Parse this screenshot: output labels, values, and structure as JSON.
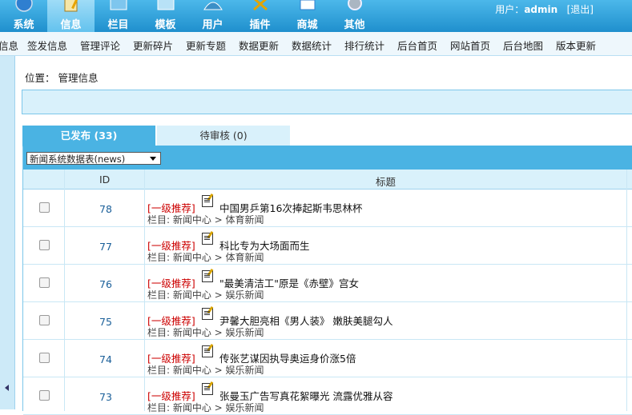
{
  "header": {
    "nav": [
      {
        "label": "系统",
        "icon": "globe-icon"
      },
      {
        "label": "信息",
        "icon": "notepad-icon",
        "active": true
      },
      {
        "label": "栏目",
        "icon": "window-icon"
      },
      {
        "label": "模板",
        "icon": "template-icon"
      },
      {
        "label": "用户",
        "icon": "user-icon"
      },
      {
        "label": "插件",
        "icon": "tools-icon"
      },
      {
        "label": "商城",
        "icon": "shop-icon"
      },
      {
        "label": "其他",
        "icon": "gear-icon"
      }
    ],
    "user_prefix": "用户：",
    "username": "admin",
    "logout": "[退出]"
  },
  "subnav": [
    "信息",
    "签发信息",
    "管理评论",
    "更新碎片",
    "更新专题",
    "数据更新",
    "数据统计",
    "排行统计",
    "后台首页",
    "网站首页",
    "后台地图",
    "版本更新"
  ],
  "breadcrumb": {
    "prefix": "位置：",
    "current": "管理信息"
  },
  "tabs": {
    "published": "已发布 (33)",
    "pending": "待审核 (0)"
  },
  "table_select": "新闻系统数据表(news)",
  "columns": {
    "id": "ID",
    "title": "标题"
  },
  "rows": [
    {
      "id": "78",
      "tag": "[一级推荐]",
      "title": "中国男乒第16次捧起斯韦思林杯",
      "category": "栏目: 新闻中心 > 体育新闻"
    },
    {
      "id": "77",
      "tag": "[一级推荐]",
      "title": "科比专为大场面而生",
      "category": "栏目: 新闻中心 > 体育新闻"
    },
    {
      "id": "76",
      "tag": "[一级推荐]",
      "title": "\"最美清洁工\"原是《赤壁》宫女",
      "category": "栏目: 新闻中心 > 娱乐新闻"
    },
    {
      "id": "75",
      "tag": "[一级推荐]",
      "title": "尹馨大胆亮相《男人装》 嫩肤美腿勾人",
      "category": "栏目: 新闻中心 > 娱乐新闻"
    },
    {
      "id": "74",
      "tag": "[一级推荐]",
      "title": "传张艺谋因执导奥运身价涨5倍",
      "category": "栏目: 新闻中心 > 娱乐新闻"
    },
    {
      "id": "73",
      "tag": "[一级推荐]",
      "title": "张曼玉广告写真花絮曝光 流露优雅从容",
      "category": "栏目: 新闻中心 > 娱乐新闻"
    }
  ]
}
